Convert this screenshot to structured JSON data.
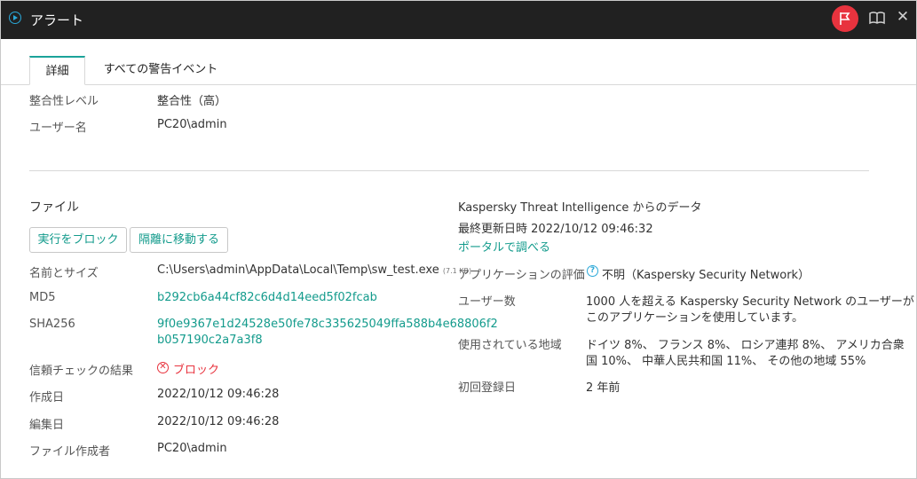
{
  "window": {
    "title": "アラート"
  },
  "tabs": [
    {
      "label": "詳細",
      "active": true
    },
    {
      "label": "すべての警告イベント",
      "active": false
    }
  ],
  "top_fields": [
    {
      "label": "整合性レベル",
      "value": "整合性（高）"
    },
    {
      "label": "ユーザー名",
      "value": "PC20\\admin"
    }
  ],
  "file": {
    "heading": "ファイル",
    "buttons": {
      "block": "実行をブロック",
      "quarantine": "隔離に移動する"
    },
    "name_size_label": "名前とサイズ",
    "path": "C:\\Users\\admin\\AppData\\Local\\Temp\\sw_test.exe",
    "size": "(7.1 KB)",
    "md5_label": "MD5",
    "md5": "b292cb6a44cf82c6d4d14eed5f02fcab",
    "sha256_label": "SHA256",
    "sha256_line1": "9f0e9367e1d24528e50fe78c335625049ffa588b4e68806f2",
    "sha256_line2": "b057190c2a7a3f8",
    "trust_label": "信頼チェックの結果",
    "trust_value": "ブロック",
    "created_label": "作成日",
    "created": "2022/10/12 09:46:28",
    "modified_label": "編集日",
    "modified": "2022/10/12 09:46:28",
    "creator_label": "ファイル作成者",
    "creator": "PC20\\admin"
  },
  "kti": {
    "heading": "Kaspersky Threat Intelligence からのデータ",
    "updated_label": "最終更新日時",
    "updated": "2022/10/12 09:46:32",
    "portal_link": "ポータルで調べる",
    "rating_label": "アプリケーションの評価",
    "rating_value": "不明（Kaspersky Security Network）",
    "users_label": "ユーザー数",
    "users_line1": "1000 人を超える Kaspersky Security Network のユーザーが",
    "users_line2": "このアプリケーションを使用しています。",
    "regions_label": "使用されている地域",
    "regions_line1": "ドイツ 8%、 フランス 8%、 ロシア連邦 8%、 アメリカ合衆",
    "regions_line2": "国 10%、 中華人民共和国 11%、 その他の地域 55%",
    "first_seen_label": "初回登録日",
    "first_seen": "2 年前"
  },
  "colors": {
    "accent": "#139b8c",
    "danger": "#e8333e",
    "titlebar": "#212121"
  },
  "icons": [
    "app-icon",
    "flag-icon",
    "book-icon",
    "close-icon",
    "block-icon",
    "help-icon"
  ]
}
